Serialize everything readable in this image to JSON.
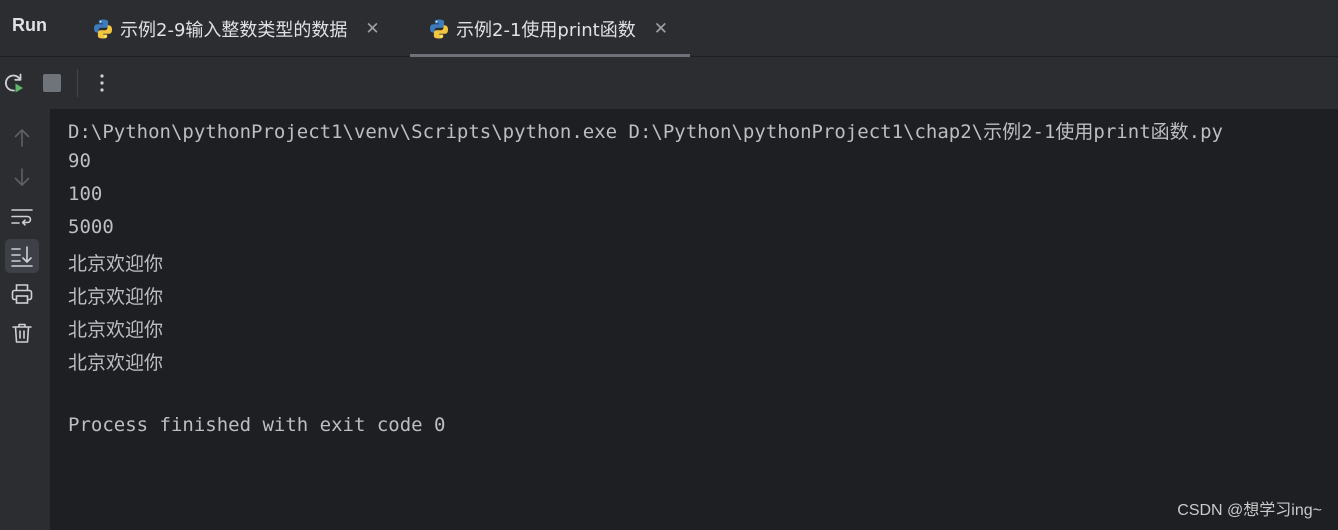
{
  "panel": {
    "title": "Run"
  },
  "tabs": [
    {
      "label": "示例2-9输入整数类型的数据",
      "icon": "python-file-icon",
      "active": false
    },
    {
      "label": "示例2-1使用print函数",
      "icon": "python-file-icon",
      "active": true
    }
  ],
  "toolbar": {
    "rerun_icon": "rerun-icon",
    "stop_icon": "stop-icon",
    "more_icon": "more-vertical-icon"
  },
  "gutter": {
    "icons": [
      "up-arrow-icon",
      "down-arrow-icon",
      "soft-wrap-icon",
      "scroll-to-end-icon",
      "print-icon",
      "trash-icon"
    ]
  },
  "console": {
    "lines": [
      "D:\\Python\\pythonProject1\\venv\\Scripts\\python.exe D:\\Python\\pythonProject1\\chap2\\示例2-1使用print函数.py",
      "90",
      "100",
      "5000",
      "北京欢迎你",
      "北京欢迎你",
      "北京欢迎你",
      "北京欢迎你",
      "",
      "Process finished with exit code 0"
    ]
  },
  "watermark": "CSDN @想学习ing~",
  "colors": {
    "background": "#1e1f22",
    "panel": "#2b2d30",
    "text": "#bcbec4",
    "rerun_green": "#5fb865"
  }
}
